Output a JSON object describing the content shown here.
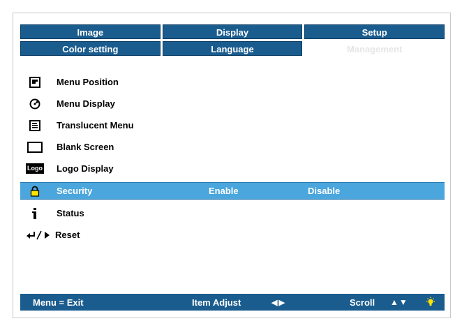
{
  "tabs": {
    "row1": [
      "Image",
      "Display",
      "Setup"
    ],
    "row2": [
      "Color setting",
      "Language",
      "Management"
    ],
    "active": "Management"
  },
  "menu": {
    "items": [
      {
        "label": "Menu Position",
        "icon": "menu-position-icon"
      },
      {
        "label": "Menu Display",
        "icon": "menu-display-icon"
      },
      {
        "label": "Translucent Menu",
        "icon": "translucent-menu-icon"
      },
      {
        "label": "Blank Screen",
        "icon": "blank-screen-icon"
      },
      {
        "label": "Logo Display",
        "icon": "logo-display-icon",
        "icon_text": "Logo"
      },
      {
        "label": "Security",
        "icon": "lock-icon",
        "selected": true,
        "options": [
          "Enable",
          "Disable"
        ]
      },
      {
        "label": "Status",
        "icon": "info-icon"
      },
      {
        "label": "Reset",
        "icon": "reset-icon"
      }
    ]
  },
  "footer": {
    "exit": "Menu = Exit",
    "adjust": "Item Adjust",
    "adjust_arrows": "◀▶",
    "scroll": "Scroll",
    "scroll_arrows": "▲▼"
  },
  "colors": {
    "tab_bg": "#1a5c8e",
    "selected_row": "#4aa6dc",
    "footer_bg": "#1a5c8e"
  }
}
